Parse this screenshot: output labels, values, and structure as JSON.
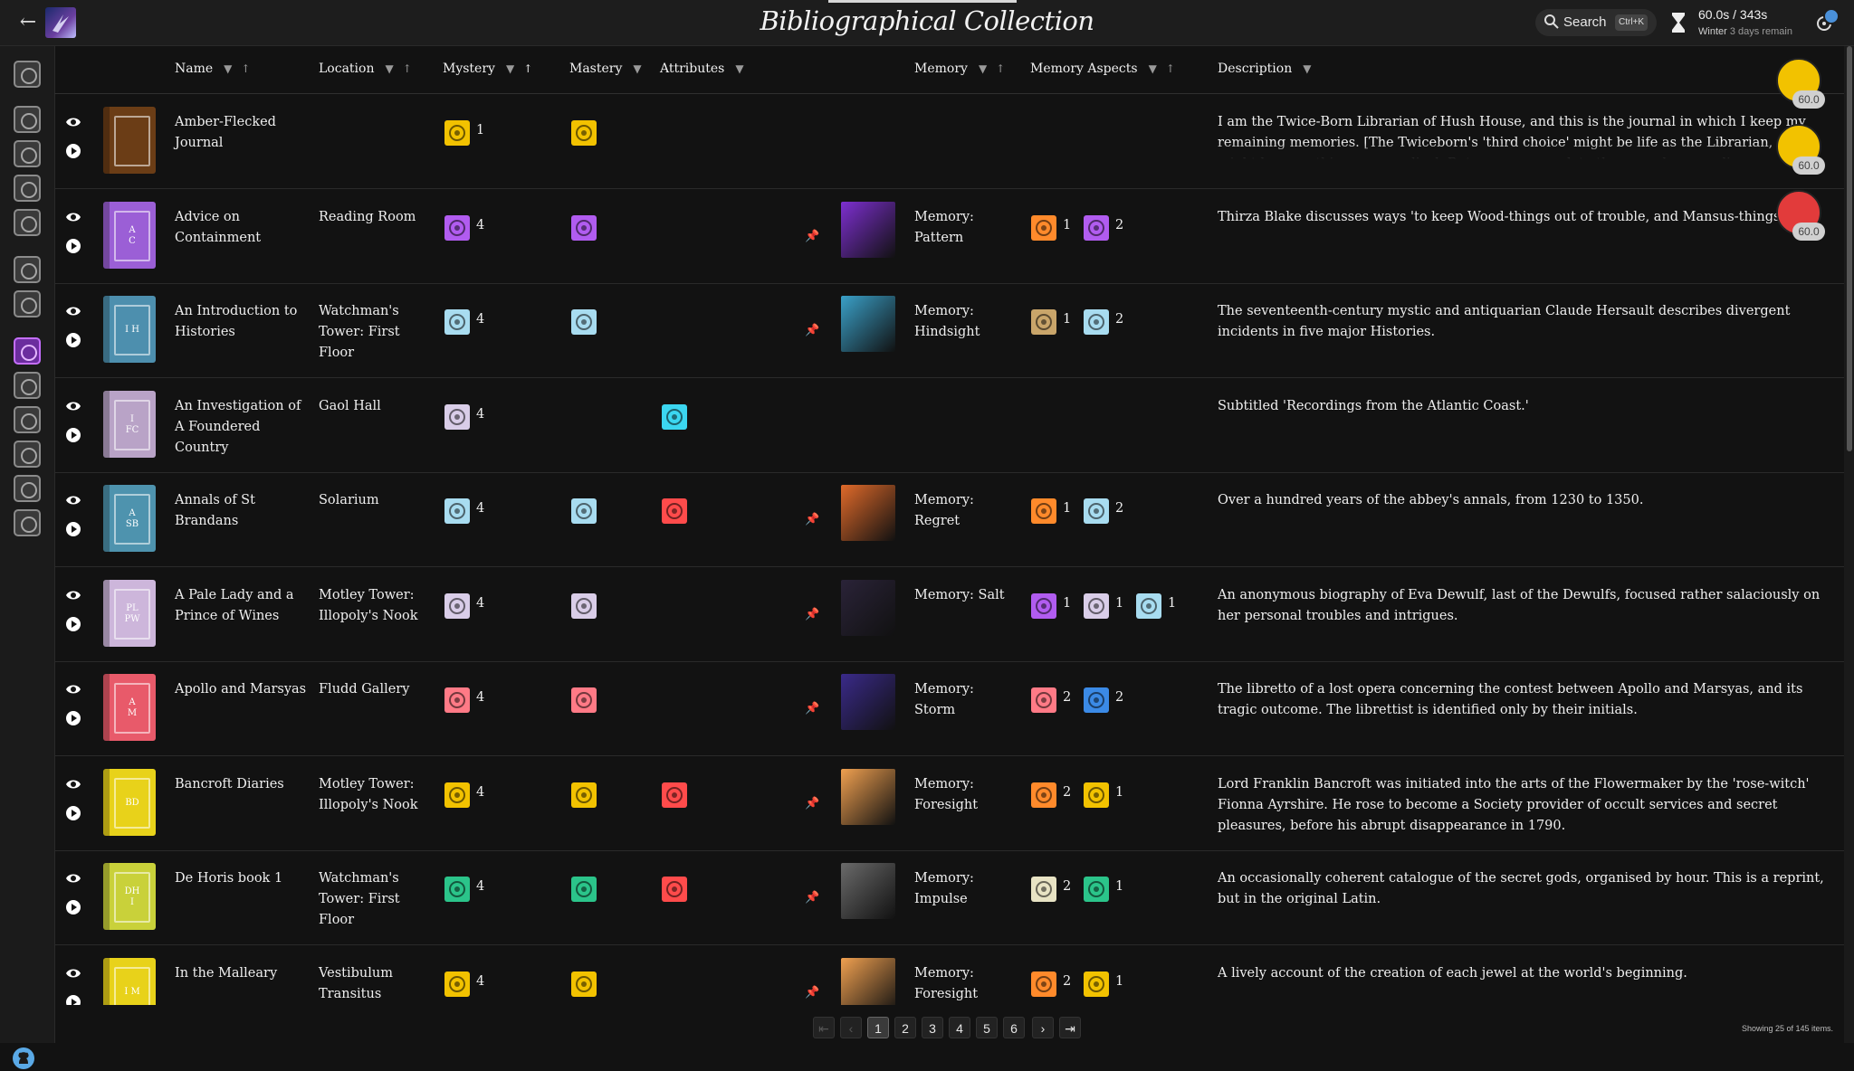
{
  "app": {
    "title": "Bibliographical Collection",
    "search_label": "Search",
    "search_shortcut": "Ctrl+K",
    "time_current": "60.0s",
    "time_total": "343s",
    "season": "Winter",
    "days_remain": "3 days remain"
  },
  "columns": {
    "name": "Name",
    "location": "Location",
    "mystery": "Mystery",
    "mastery": "Mastery",
    "attributes": "Attributes",
    "memory": "Memory",
    "memory_aspects": "Memory Aspects",
    "description": "Description"
  },
  "colors": {
    "lantern": "#f2c200",
    "knock": "#a04de0",
    "heart": "#ff6b73",
    "grail": "#ff6b73",
    "winter": "#e3d9f2",
    "moon": "#d9cde8",
    "sky": "#48a8e0",
    "nectar": "#2bc48a",
    "edge": "#e8d255",
    "forge": "#ff8a2b",
    "scale": "#c9a56a",
    "moth": "#e8e3c4",
    "rose": "#ff7a7a",
    "secret": "#3bb0e6",
    "weapon": "#ff4b4b"
  },
  "rows": [
    {
      "name": "Amber-Flecked Journal",
      "location": "",
      "cover": "#6b3d16",
      "cover_text": "",
      "mystery_icon": "lantern-icon",
      "mystery_color": "#f2c200",
      "mystery_level": "1",
      "mastery_icon": "lantern-icon",
      "mastery_color": "#f2c200",
      "attribute": "",
      "pinned": false,
      "memory_image": "",
      "memory_name": "",
      "memory_aspects": [],
      "description": "I am the Twice-Born Librarian of Hush House, and this is the journal in which I keep my remaining memories. [The Twiceborn's 'third choice' might be life as the Librarian, or it might be something more radical. But you can complete the game by recording any History. You might wish to begin your study"
    },
    {
      "name": "Advice on Containment",
      "location": "Reading Room",
      "cover": "#9b5fd6",
      "cover_text": "A\nC",
      "mystery_icon": "knock-icon",
      "mystery_color": "#b15cf0",
      "mystery_level": "4",
      "mastery_icon": "knock-icon",
      "mastery_color": "#b15cf0",
      "attribute": "",
      "pinned": true,
      "memory_image": "#7d2fd0",
      "memory_name": "Memory: Pattern",
      "memory_aspects": [
        {
          "icon": "forge-icon",
          "color": "#ff8a2b",
          "value": "1"
        },
        {
          "icon": "knock-icon",
          "color": "#b15cf0",
          "value": "2"
        }
      ],
      "description": "Thirza Blake discusses ways 'to keep Wood-things out of trouble, and Mansus-things in it.'"
    },
    {
      "name": "An Introduction to Histories",
      "location": "Watchman's Tower: First Floor",
      "cover": "#4d8fae",
      "cover_text": "I H",
      "mystery_icon": "sky-icon",
      "mystery_color": "#a8dcf0",
      "mystery_level": "4",
      "mastery_icon": "sky-icon",
      "mastery_color": "#a8dcf0",
      "attribute": "",
      "pinned": true,
      "memory_image": "#3aa0c8",
      "memory_name": "Memory: Hindsight",
      "memory_aspects": [
        {
          "icon": "scale-icon",
          "color": "#c9a56a",
          "value": "1"
        },
        {
          "icon": "sky-icon",
          "color": "#a8dcf0",
          "value": "2"
        }
      ],
      "description": "The seventeenth-century mystic and antiquarian Claude Hersault describes divergent incidents in five major Histories."
    },
    {
      "name": "An Investigation of A Foundered Country",
      "location": "Gaol Hall",
      "cover": "#b9a3c7",
      "cover_text": "I\nFC",
      "mystery_icon": "moon-icon",
      "mystery_color": "#d9cde8",
      "mystery_level": "4",
      "mastery_icon": "",
      "mastery_color": "",
      "attribute": "#3bd6f0",
      "pinned": false,
      "memory_image": "",
      "memory_name": "",
      "memory_aspects": [],
      "description": "Subtitled 'Recordings from the Atlantic Coast.'"
    },
    {
      "name": "Annals of St Brandans",
      "location": "Solarium",
      "cover": "#4e93ae",
      "cover_text": "A\nSB",
      "mystery_icon": "sky-icon",
      "mystery_color": "#a8dcf0",
      "mystery_level": "4",
      "mastery_icon": "sky-icon",
      "mastery_color": "#a8dcf0",
      "attribute": "#ff4b4b",
      "pinned": true,
      "memory_image": "#e06a2a",
      "memory_name": "Memory: Regret",
      "memory_aspects": [
        {
          "icon": "forge-icon",
          "color": "#ff8a2b",
          "value": "1"
        },
        {
          "icon": "sky-icon",
          "color": "#a8dcf0",
          "value": "2"
        }
      ],
      "description": "Over a hundred years of the abbey's annals, from 1230 to 1350."
    },
    {
      "name": "A Pale Lady and a Prince of Wines",
      "location": "Motley Tower: Illopoly's Nook",
      "cover": "#cdb6db",
      "cover_text": "PL\nPW",
      "mystery_icon": "moon-icon",
      "mystery_color": "#d9cde8",
      "mystery_level": "4",
      "mastery_icon": "moon-icon",
      "mastery_color": "#d9cde8",
      "attribute": "",
      "pinned": true,
      "memory_image": "#2a2338",
      "memory_name": "Memory: Salt",
      "memory_aspects": [
        {
          "icon": "knock-icon",
          "color": "#b15cf0",
          "value": "1"
        },
        {
          "icon": "moon-icon",
          "color": "#d9cde8",
          "value": "1"
        },
        {
          "icon": "sky-icon",
          "color": "#a8dcf0",
          "value": "1"
        }
      ],
      "description": "An anonymous biography of Eva Dewulf, last of the Dewulfs, focused rather salaciously on her personal troubles and intrigues."
    },
    {
      "name": "Apollo and Marsyas",
      "location": "Fludd Gallery",
      "cover": "#e85a6a",
      "cover_text": "A\nM",
      "mystery_icon": "grail-icon",
      "mystery_color": "#ff7a86",
      "mystery_level": "4",
      "mastery_icon": "grail-icon",
      "mastery_color": "#ff7a86",
      "attribute": "",
      "pinned": true,
      "memory_image": "#3a2a8a",
      "memory_name": "Memory: Storm",
      "memory_aspects": [
        {
          "icon": "grail-icon",
          "color": "#ff7a86",
          "value": "2"
        },
        {
          "icon": "secret-icon",
          "color": "#3b8ae6",
          "value": "2"
        }
      ],
      "description": "The libretto of a lost opera concerning the contest between Apollo and Marsyas, and its tragic outcome. The librettist is identified only by their initials."
    },
    {
      "name": "Bancroft Diaries",
      "location": "Motley Tower: Illopoly's Nook",
      "cover": "#e8d21a",
      "cover_text": "BD",
      "mystery_icon": "lantern-icon",
      "mystery_color": "#f2c200",
      "mystery_level": "4",
      "mastery_icon": "lantern-icon",
      "mastery_color": "#f2c200",
      "attribute": "#ff4b4b",
      "pinned": true,
      "memory_image": "#f0a050",
      "memory_name": "Memory: Foresight",
      "memory_aspects": [
        {
          "icon": "forge-icon",
          "color": "#ff8a2b",
          "value": "2"
        },
        {
          "icon": "lantern-icon",
          "color": "#f2c200",
          "value": "1"
        }
      ],
      "description": "Lord Franklin Bancroft was initiated into the arts of the Flowermaker by the 'rose-witch' Fionna Ayrshire. He rose to become a Society provider of occult services and secret pleasures, before his abrupt disappearance in 1790."
    },
    {
      "name": "De Horis book 1",
      "location": "Watchman's Tower: First Floor",
      "cover": "#c9d13a",
      "cover_text": "DH\nI",
      "mystery_icon": "nectar-icon",
      "mystery_color": "#2bc48a",
      "mystery_level": "4",
      "mastery_icon": "nectar-icon",
      "mastery_color": "#2bc48a",
      "attribute": "#ff4b4b",
      "pinned": true,
      "memory_image": "#6a6a6a",
      "memory_name": "Memory: Impulse",
      "memory_aspects": [
        {
          "icon": "moth-icon",
          "color": "#e8e3c4",
          "value": "2"
        },
        {
          "icon": "nectar-icon",
          "color": "#2bc48a",
          "value": "1"
        }
      ],
      "description": "An occasionally coherent catalogue of the secret gods, organised by hour. This is a reprint, but in the original Latin."
    },
    {
      "name": "In the Malleary",
      "location": "Vestibulum Transitus",
      "cover": "#e8d21a",
      "cover_text": "I M",
      "mystery_icon": "lantern-icon",
      "mystery_color": "#f2c200",
      "mystery_level": "4",
      "mastery_icon": "lantern-icon",
      "mastery_color": "#f2c200",
      "attribute": "",
      "pinned": true,
      "memory_image": "#f0a050",
      "memory_name": "Memory: Foresight",
      "memory_aspects": [
        {
          "icon": "forge-icon",
          "color": "#ff8a2b",
          "value": "2"
        },
        {
          "icon": "lantern-icon",
          "color": "#f2c200",
          "value": "1"
        }
      ],
      "description": "A lively account of the creation of each jewel at the world's beginning."
    }
  ],
  "floating_badges": [
    {
      "icon": "lantern-badge-icon",
      "color": "#f2c200",
      "value": "60.0"
    },
    {
      "icon": "lantern-badge-icon",
      "color": "#f2c200",
      "value": "60.0"
    },
    {
      "icon": "edge-badge-icon",
      "color": "#e23b3b",
      "value": "60.0"
    }
  ],
  "pagination": {
    "pages": [
      "1",
      "2",
      "3",
      "4",
      "5",
      "6"
    ],
    "current": "1",
    "showing": "Showing 25 of 145 items."
  },
  "sidebar": {
    "icons": [
      "grail-chest-icon",
      "knock-shelf-icon",
      "moon-shelf-icon",
      "forge-shelf-icon",
      "winter-shelf-icon",
      "lantern-shelf-icon",
      "heart-shelf-icon",
      "knock-purple-icon",
      "edge-shelf-icon",
      "sky-shelf-icon",
      "nectar-shelf-icon",
      "moth-shelf-icon",
      "scale-shelf-icon"
    ]
  }
}
